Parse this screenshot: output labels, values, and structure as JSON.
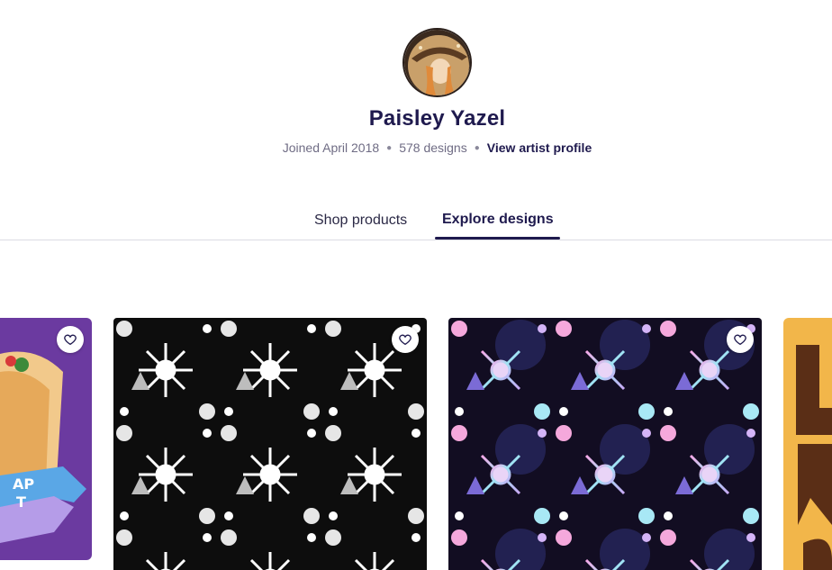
{
  "artist": {
    "name": "Paisley Yazel",
    "joined": "Joined April 2018",
    "designs_count": "578 designs",
    "profile_link": "View artist profile"
  },
  "tabs": [
    {
      "label": "Shop products",
      "active": false
    },
    {
      "label": "Explore designs",
      "active": true
    }
  ],
  "designs": [
    {
      "icon": "heart-icon",
      "theme": "purple wrap illustration"
    },
    {
      "icon": "heart-icon",
      "theme": "black and white skull snowflake pattern"
    },
    {
      "icon": "heart-icon",
      "theme": "pastel rainbow skull snowflake pattern"
    },
    {
      "icon": "heart-icon",
      "theme": "gold lettering"
    }
  ],
  "colors": {
    "brand": "#1f1a4e",
    "muted": "#6f6c84",
    "divider": "#dcdce3"
  }
}
